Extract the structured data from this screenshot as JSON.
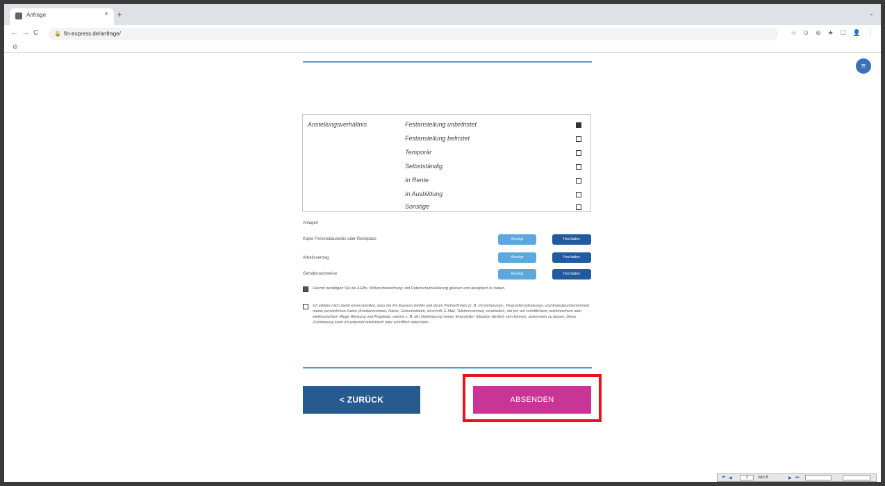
{
  "browser": {
    "tab_title": "Anfrage",
    "tab_close": "×",
    "new_tab": "+",
    "tab_menu": "⌄",
    "url": "fin-express.de/anfrage/",
    "nav_back": "←",
    "nav_forward": "→",
    "nav_reload": "C",
    "lock": "🔒",
    "toolbar_icons": [
      "☆",
      "⊙",
      "⊛",
      "★",
      "☐",
      "👤",
      "⋮"
    ]
  },
  "page": {
    "side_button_icon": "≡",
    "employment": {
      "label": "Anstellungsverhältnis",
      "options": [
        {
          "label": "Festanstellung unbefristet",
          "checked": true
        },
        {
          "label": "Festanstellung befristet",
          "checked": false
        },
        {
          "label": "Temporär",
          "checked": false
        },
        {
          "label": "Selbstständig",
          "checked": false
        },
        {
          "label": "In Rente",
          "checked": false
        },
        {
          "label": "In Ausbildung",
          "checked": false
        },
        {
          "label": "Sonstige",
          "checked": false
        }
      ]
    },
    "attachments": {
      "heading": "Anlagen",
      "rows": [
        {
          "label": "Kopie Personalausweis oder Reisepass",
          "view": "Anzeige",
          "upload": "Hochladen"
        },
        {
          "label": "Arbeitsvertrag",
          "view": "Anzeige",
          "upload": "Hochladen"
        },
        {
          "label": "Gehaltsnachweise",
          "view": "Anzeige",
          "upload": "Hochladen"
        }
      ]
    },
    "consent_1": {
      "checked": true,
      "text": "Hiermit bestätigen Sie die AGBs, Widerrufsbelehrung und Datenschutzerklärung gelesen und akzeptiert zu haben."
    },
    "consent_2": {
      "checked": false,
      "text": "Ich erkläre mich damit einverstanden, dass die Fin Express GmbH und deren Partnerfirmen (z. B. Versicherungs-, Finanzdienstleistungs- und Energieunternehmen) meine persönlichen Daten (Kundennummer, Name, Geburtsdatum, Anschrift, E-Mail, Telefonnummer) verarbeiten, um mir auf schriftlichem, telefonischem oder elektronischem Wege Werbung und Angebote, welche z. B. der Optimierung meiner finanziellen Situation dienlich sein können, zukommen zu lassen. Diese Zustimmung kann ich jederzeit telefonisch oder schriftlich widerrufen."
    },
    "back_button": "< ZURÜCK",
    "submit_button": "ABSENDEN"
  },
  "pager": {
    "first": "⏮",
    "prev": "◀",
    "page": "1",
    "of": "von 6",
    "next": "▶",
    "last": "⏭"
  },
  "colors": {
    "accent_blue": "#4d9bd3",
    "back_button": "#275a8e",
    "submit_button": "#c93596",
    "highlight": "#e8141a"
  }
}
